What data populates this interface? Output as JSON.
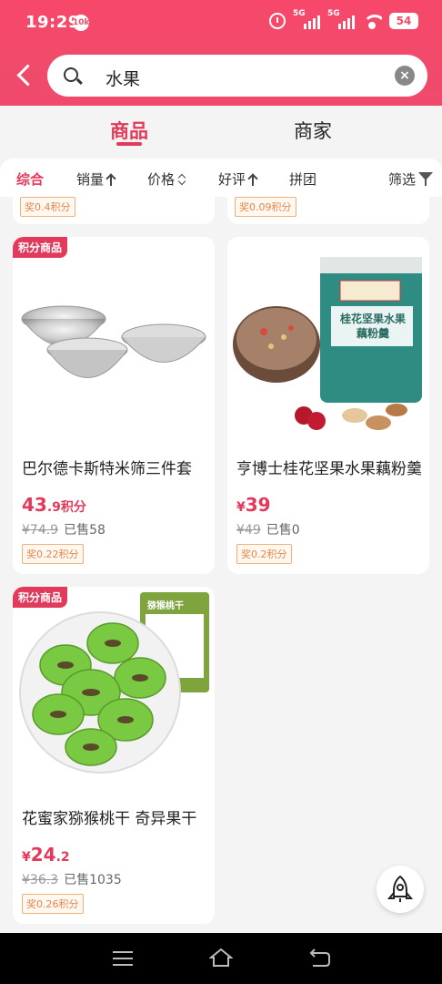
{
  "status_bar": {
    "time": "19:29",
    "hd_badge": "10k",
    "signal1_label": "5G",
    "signal2_label": "5G",
    "battery": "54"
  },
  "search": {
    "query": "水果"
  },
  "tabs": [
    {
      "label": "商品",
      "active": true
    },
    {
      "label": "商家",
      "active": false
    }
  ],
  "filters": [
    {
      "label": "综合",
      "active": true,
      "icon": ""
    },
    {
      "label": "销量",
      "active": false,
      "icon": "arrow-up-icon"
    },
    {
      "label": "价格",
      "active": false,
      "icon": "sort-updown-icon"
    },
    {
      "label": "好评",
      "active": false,
      "icon": "arrow-up-icon"
    },
    {
      "label": "拼团",
      "active": false,
      "icon": ""
    },
    {
      "label": "筛选",
      "active": false,
      "icon": "filter-funnel-icon"
    }
  ],
  "peek_cards": [
    {
      "points": "奖0.4积分"
    },
    {
      "points": "奖0.09积分"
    }
  ],
  "products": [
    {
      "tag": "积分商品",
      "title": "巴尔德卡斯特米筛三件套",
      "price_main": "43",
      "price_decimal": ".9积分",
      "original_price": "¥74.9",
      "sold": "已售58",
      "points": "奖0.22积分",
      "image": "stainless-bowls-image"
    },
    {
      "tag": "",
      "title": "亨博士桂花坚果水果藕粉羹",
      "price_main": "39",
      "price_decimal": "",
      "currency": "¥",
      "original_price": "¥49",
      "sold": "已售0",
      "points": "奖0.2积分",
      "image": "lotus-root-powder-image",
      "package_text": "桂花坚果水果藕粉羹"
    },
    {
      "tag": "积分商品",
      "title": "花蜜家猕猴桃干 奇异果干",
      "price_main": "24",
      "price_decimal": ".2",
      "currency": "¥",
      "original_price": "¥36.3",
      "sold": "已售1035",
      "points": "奖0.26积分",
      "image": "dried-kiwi-image",
      "package_text": "猕猴桃干"
    }
  ],
  "colors": {
    "accent": "#e23a5b",
    "header_gradient": "#f7486a",
    "points_badge": "#e5864a"
  },
  "icons": {
    "back": "chevron-left-icon",
    "search": "search-icon",
    "clear": "clear-circle-icon",
    "rocket": "rocket-icon"
  }
}
